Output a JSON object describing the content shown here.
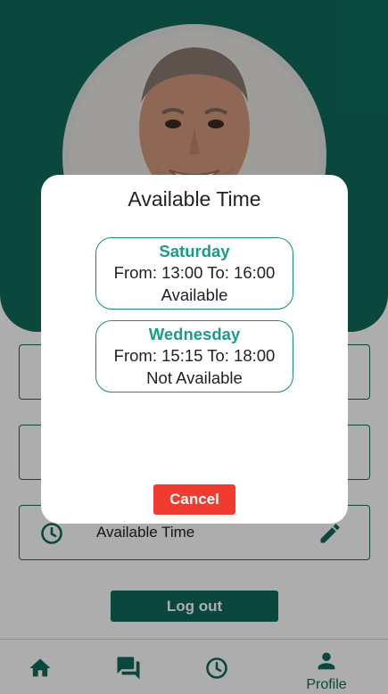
{
  "profile": {
    "fields": [
      {
        "label": ""
      },
      {
        "label": ""
      },
      {
        "label": "Available Time"
      }
    ],
    "logout_label": "Log out"
  },
  "nav": {
    "items": [
      {
        "icon": "home-icon",
        "label": ""
      },
      {
        "icon": "chat-icon",
        "label": ""
      },
      {
        "icon": "clock-icon",
        "label": ""
      },
      {
        "icon": "person-icon",
        "label": "Profile"
      }
    ]
  },
  "dialog": {
    "title": "Available Time",
    "slots": [
      {
        "day": "Saturday",
        "time": "From: 13:00 To: 16:00",
        "status": "Available"
      },
      {
        "day": "Wednesday",
        "time": "From: 15:15 To: 18:00",
        "status": "Not Available"
      }
    ],
    "cancel_label": "Cancel"
  },
  "colors": {
    "primary": "#0f6b5c",
    "accent_text": "#1a9c86",
    "danger": "#f13a30"
  }
}
